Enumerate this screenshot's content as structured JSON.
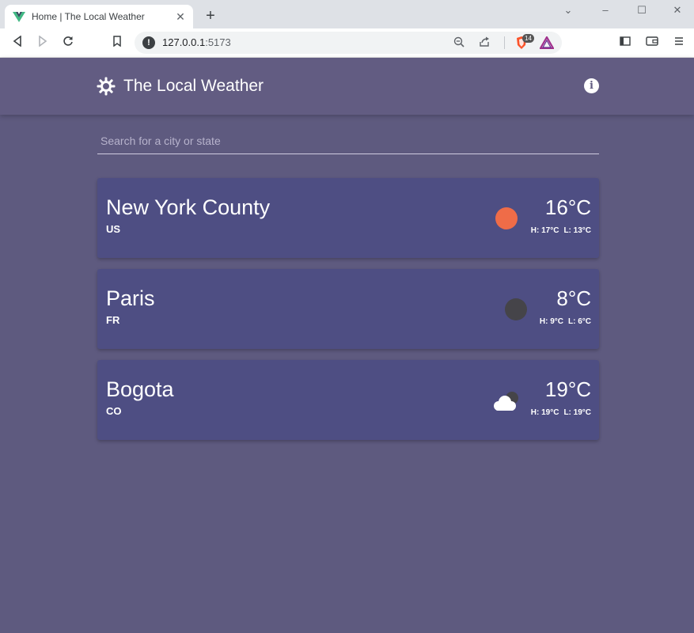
{
  "browser": {
    "tab_title": "Home | The Local Weather",
    "url_host": "127.0.0.1",
    "url_port": ":5173",
    "shield_count": "14"
  },
  "app": {
    "title": "The Local Weather",
    "search_placeholder": "Search for a city or state"
  },
  "cities": [
    {
      "name": "New York County",
      "country": "US",
      "temp": "16°C",
      "high": "H: 17°C",
      "low": "L: 13°C",
      "icon": "sun-icon"
    },
    {
      "name": "Paris",
      "country": "FR",
      "temp": "8°C",
      "high": "H: 9°C",
      "low": "L: 6°C",
      "icon": "moon-icon"
    },
    {
      "name": "Bogota",
      "country": "CO",
      "temp": "19°C",
      "high": "H: 19°C",
      "low": "L: 19°C",
      "icon": "cloud-night-icon"
    }
  ],
  "colors": {
    "background": "#5e5a7f",
    "header": "#625c82",
    "card": "#4e4e83",
    "sun": "#ef6c48",
    "moon": "#454449"
  }
}
